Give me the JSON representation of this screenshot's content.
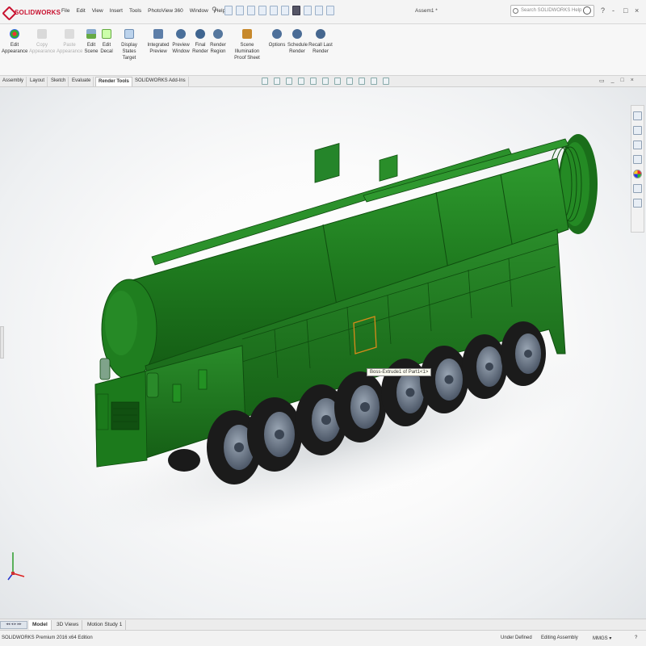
{
  "app": {
    "logo_text": "SOLIDWORKS",
    "menu": [
      "File",
      "Edit",
      "View",
      "Insert",
      "Tools",
      "PhotoView 360",
      "Window",
      "Help"
    ],
    "document_title": "Assem1 *",
    "search_placeholder": "Search SOLIDWORKS Help",
    "window_controls": [
      "?",
      "-",
      "□",
      "×"
    ]
  },
  "ribbon": {
    "buttons": [
      {
        "line1": "Edit",
        "line2": "Appearance",
        "icon": "appearance-icon",
        "enabled": true
      },
      {
        "line1": "Copy",
        "line2": "Appearance",
        "icon": "copy-appearance-icon",
        "enabled": false
      },
      {
        "line1": "Paste",
        "line2": "Appearance",
        "icon": "paste-appearance-icon",
        "enabled": false
      },
      {
        "line1": "Edit",
        "line2": "Scene",
        "icon": "scene-icon",
        "enabled": true
      },
      {
        "line1": "Edit",
        "line2": "Decal",
        "icon": "decal-icon",
        "enabled": true
      },
      {
        "line1": "Display States",
        "line2": "Target",
        "icon": "display-states-icon",
        "enabled": true
      },
      {
        "line1": "Integrated",
        "line2": "Preview",
        "icon": "integrated-preview-icon",
        "enabled": true
      },
      {
        "line1": "Preview",
        "line2": "Window",
        "icon": "preview-window-icon",
        "enabled": true
      },
      {
        "line1": "Final",
        "line2": "Render",
        "icon": "final-render-icon",
        "enabled": true
      },
      {
        "line1": "Render",
        "line2": "Region",
        "icon": "render-region-icon",
        "enabled": true
      },
      {
        "line1": "Scene Illumination",
        "line2": "Proof Sheet",
        "icon": "illumination-icon",
        "enabled": true
      },
      {
        "line1": "Options",
        "line2": "",
        "icon": "options-icon",
        "enabled": true
      },
      {
        "line1": "Schedule",
        "line2": "Render",
        "icon": "schedule-render-icon",
        "enabled": true
      },
      {
        "line1": "Recall Last",
        "line2": "Render",
        "icon": "recall-render-icon",
        "enabled": true
      }
    ]
  },
  "command_tabs": [
    {
      "label": "Assembly",
      "active": false
    },
    {
      "label": "Layout",
      "active": false
    },
    {
      "label": "Sketch",
      "active": false
    },
    {
      "label": "Evaluate",
      "active": false
    },
    {
      "label": "Render Tools",
      "active": true
    },
    {
      "label": "SOLIDWORKS Add-Ins",
      "active": false
    }
  ],
  "viewport": {
    "tooltip": "Boss-Extrude1 of Part1<1>",
    "model_color": "#1f7a1f",
    "model_dark": "#0f4d0f",
    "tire_color": "#1b1b1b",
    "hub_color": "#5f6b7a",
    "highlight_color": "#d98a1a"
  },
  "bottom_tabs": [
    {
      "label": "Model",
      "active": true
    },
    {
      "label": "3D Views",
      "active": false
    },
    {
      "label": "Motion Study 1",
      "active": false
    }
  ],
  "status": {
    "edition": "SOLIDWORKS Premium 2016 x64 Edition",
    "definition": "Under Defined",
    "mode": "Editing Assembly",
    "units": "MMGS",
    "units_arrow": "▾",
    "help": "?"
  }
}
